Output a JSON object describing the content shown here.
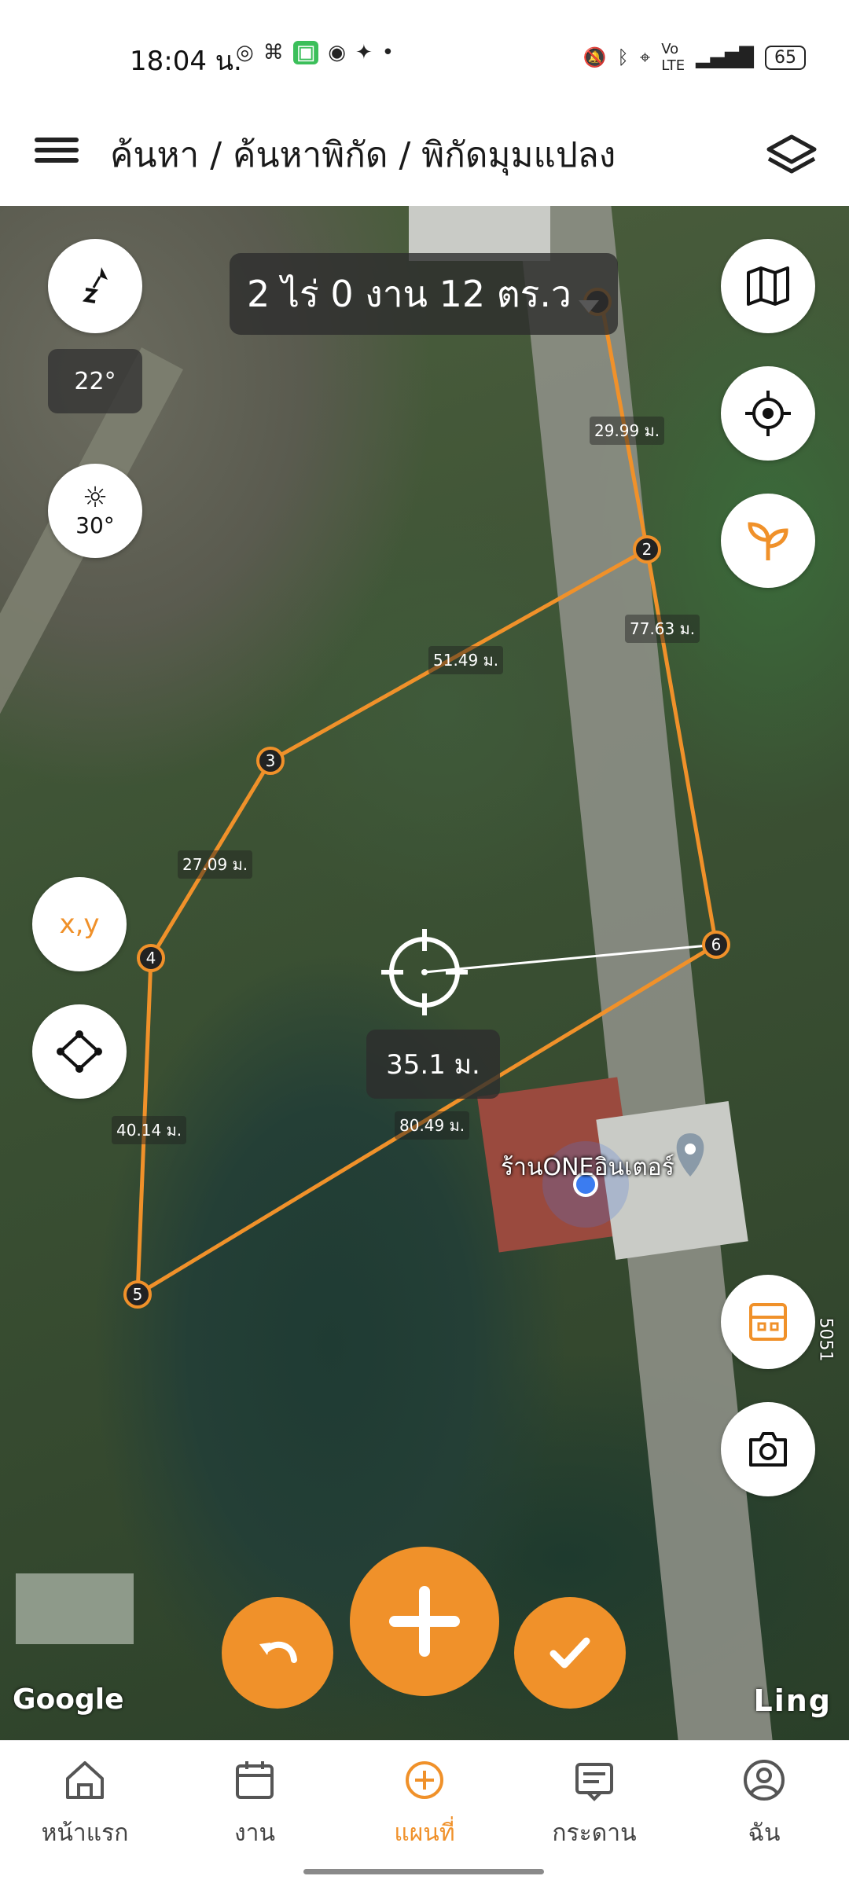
{
  "status_bar": {
    "time": "18:04 น.",
    "battery": "65",
    "icons": [
      "messenger-icon",
      "game-icon",
      "app-icon",
      "line-icon",
      "twitter-icon",
      "dot-icon",
      "mute-icon",
      "bluetooth-icon",
      "location-icon",
      "volte-icon",
      "signal-4g-icon"
    ]
  },
  "header": {
    "breadcrumb": "ค้นหา / ค้นหาพิกัด / พิกัดมุมแปลง",
    "menu_icon": "hamburger-icon",
    "layers_icon": "layers-icon"
  },
  "map": {
    "area_text": "2 ไร่ 0 งาน 12 ตร.ว",
    "compass_heading": "22°",
    "sun_angle": "30°",
    "xy_button": "x,y",
    "crosshair_distance": "35.1 ม.",
    "place_label": "ร้านONEอินเตอร์",
    "google_logo": "Google",
    "ling_label": "Ling",
    "road_number": "5051",
    "vertices": [
      "2",
      "3",
      "4",
      "5",
      "6"
    ],
    "segments": [
      {
        "label": "29.99 ม."
      },
      {
        "label": "77.63 ม."
      },
      {
        "label": "51.49 ม."
      },
      {
        "label": "27.09 ม."
      },
      {
        "label": "40.14 ม."
      },
      {
        "label": "80.49 ม."
      }
    ],
    "accent_color": "#f0912a"
  },
  "bottom_nav": {
    "items": [
      {
        "label": "หน้าแรก",
        "icon": "home-icon"
      },
      {
        "label": "งาน",
        "icon": "calendar-icon"
      },
      {
        "label": "แผนที่",
        "icon": "add-circle-icon",
        "active": true
      },
      {
        "label": "กระดาน",
        "icon": "board-icon"
      },
      {
        "label": "ฉัน",
        "icon": "profile-icon"
      }
    ]
  }
}
